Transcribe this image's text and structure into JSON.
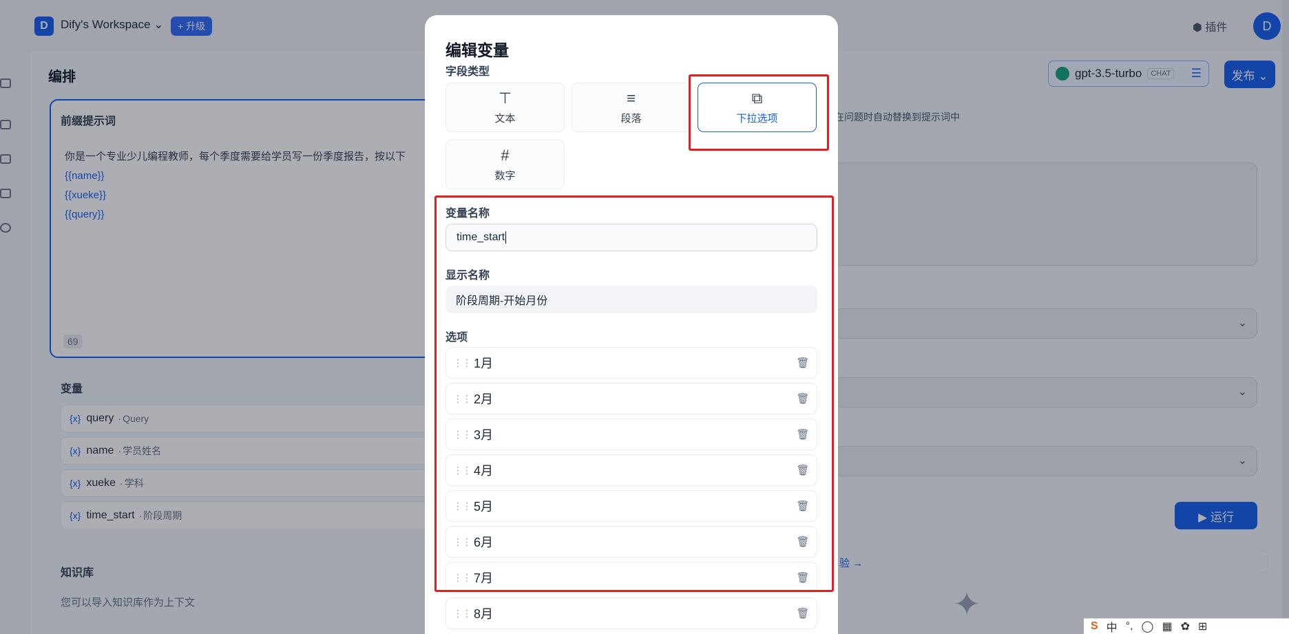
{
  "header": {
    "workspace_initial": "D",
    "workspace_name": "Dify's Workspace ⌄",
    "upgrade_label": "+ 升级",
    "plugins_label": "插件",
    "avatar_initial": "D"
  },
  "left": {
    "section_title": "编排",
    "prompt": {
      "title": "前缀提示词",
      "text": "你是一个专业少儿编程教师，每个季度需要给学员写一份季度报告，按以下",
      "vars": [
        "{{name}}",
        "{{xueke}}",
        "{{query}}"
      ],
      "char_count": "69"
    },
    "variables": {
      "title": "变量",
      "items": [
        {
          "key": "query",
          "label": "Query"
        },
        {
          "key": "name",
          "label": "学员姓名"
        },
        {
          "key": "xueke",
          "label": "学科"
        },
        {
          "key": "time_start",
          "label": "阶段周期"
        }
      ]
    },
    "knowledge": {
      "title": "知识库",
      "desc": "您可以导入知识库作为上下文"
    }
  },
  "right": {
    "model_name": "gpt-3.5-turbo",
    "model_tag": "CHAT",
    "publish_label": "发布 ⌄",
    "hint_text": "在问题时自动替换到提示词中",
    "run_label": "▶ 运行",
    "explore_label": "验 →"
  },
  "modal": {
    "title": "编辑变量",
    "field_type_label": "字段类型",
    "types": [
      {
        "icon": "text-icon",
        "glyph": "⊤",
        "label": "文本"
      },
      {
        "icon": "paragraph-icon",
        "glyph": "≡",
        "label": "段落"
      },
      {
        "icon": "dropdown-icon",
        "glyph": "⧉",
        "label": "下拉选项"
      },
      {
        "icon": "number-icon",
        "glyph": "#",
        "label": "数字"
      }
    ],
    "selected_type": "下拉选项",
    "var_name_label": "变量名称",
    "var_name_value": "time_start",
    "display_name_label": "显示名称",
    "display_name_value": "阶段周期-开始月份",
    "options_label": "选项",
    "options": [
      "1月",
      "2月",
      "3月",
      "4月",
      "5月",
      "6月",
      "7月",
      "8月"
    ]
  },
  "colors": {
    "accent": "#155eef",
    "highlight_box": "#e31e1e",
    "overlay": "rgba(16,24,40,0.35)"
  }
}
